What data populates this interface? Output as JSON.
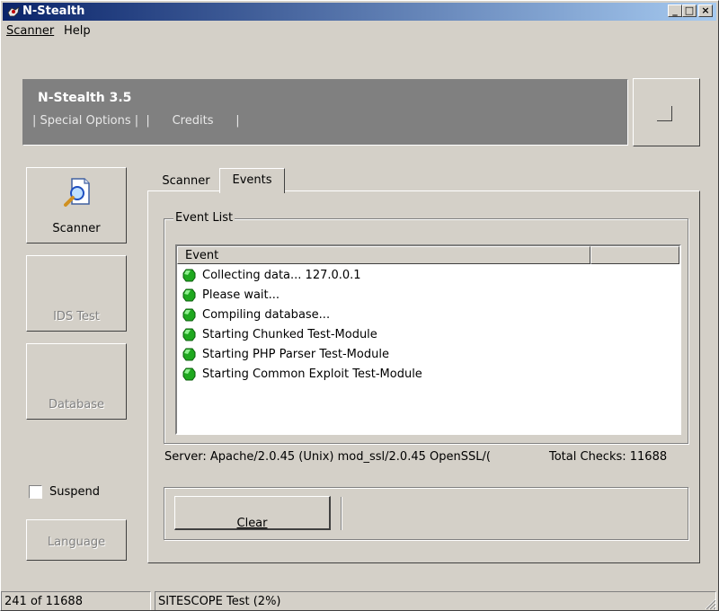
{
  "window": {
    "title": "N-Stealth",
    "title_bar_color": "#0a246a"
  },
  "title_buttons": {
    "minimize": "_",
    "maximize": "□",
    "close": "×"
  },
  "menu": {
    "scanner": "Scanner",
    "help": "Help"
  },
  "banner": {
    "title": "N-Stealth 3.5",
    "links_text": "| Special Options |  |      Credits      |",
    "background": "#808080"
  },
  "sidebar": {
    "scanner_label": "Scanner",
    "ids_test_label": "IDS Test",
    "database_label": "Database",
    "suspend_label": "Suspend",
    "language_label": "Language"
  },
  "tabs": {
    "scanner": "Scanner",
    "events": "Events",
    "active": "Events"
  },
  "event_list": {
    "group_title": "Event List",
    "column_header": "Event",
    "rows": [
      "Collecting data... 127.0.0.1",
      "Please wait...",
      "Compiling database...",
      "Starting Chunked Test-Module",
      "Starting PHP Parser Test-Module",
      "Starting Common Exploit Test-Module"
    ],
    "row_icon": "green-gem-icon",
    "row_icon_color": "#1fa81f"
  },
  "info": {
    "server": "Server: Apache/2.0.45 (Unix) mod_ssl/2.0.45 OpenSSL/(",
    "total_checks": "Total Checks: 11688"
  },
  "buttons": {
    "clear": "Clear"
  },
  "status": {
    "progress_text": "241 of 11688",
    "test_text": "SITESCOPE Test (2%)"
  }
}
